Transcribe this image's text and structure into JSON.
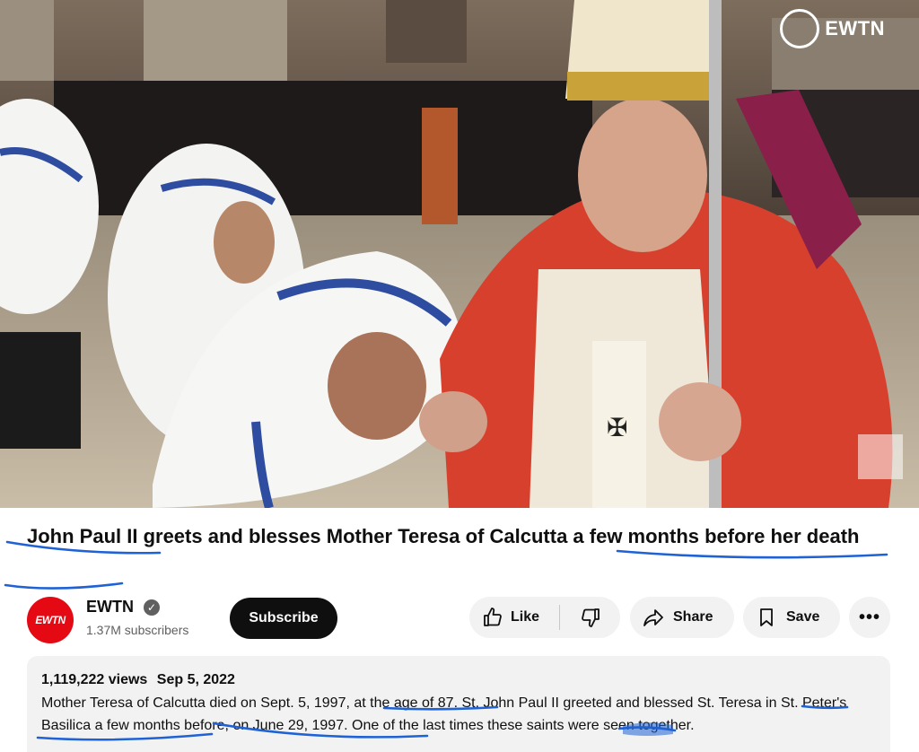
{
  "video": {
    "watermark_text": "EWTN"
  },
  "title": "John Paul II greets and blesses Mother Teresa of Calcutta a few months before her death",
  "channel": {
    "avatar_text": "EWTN",
    "name": "EWTN",
    "verified_icon": "check-icon",
    "subscribers": "1.37M subscribers",
    "subscribe_label": "Subscribe"
  },
  "actions": {
    "like_label": "Like",
    "share_label": "Share",
    "save_label": "Save",
    "more_label": "•••"
  },
  "description": {
    "views": "1,119,222 views",
    "date": "Sep 5, 2022",
    "text": "Mother Teresa of Calcutta died on Sept. 5, 1997, at the age of 87. St. John Paul II greeted and blessed St. Teresa in St. Peter's Basilica a few months before, on June 29, 1997. One of the last times these saints were seen together."
  },
  "colors": {
    "subscribe_bg": "#0f0f0f",
    "pill_bg": "#f2f2f2",
    "annotation_ink": "#1e62d6",
    "avatar_bg": "#e50914"
  }
}
